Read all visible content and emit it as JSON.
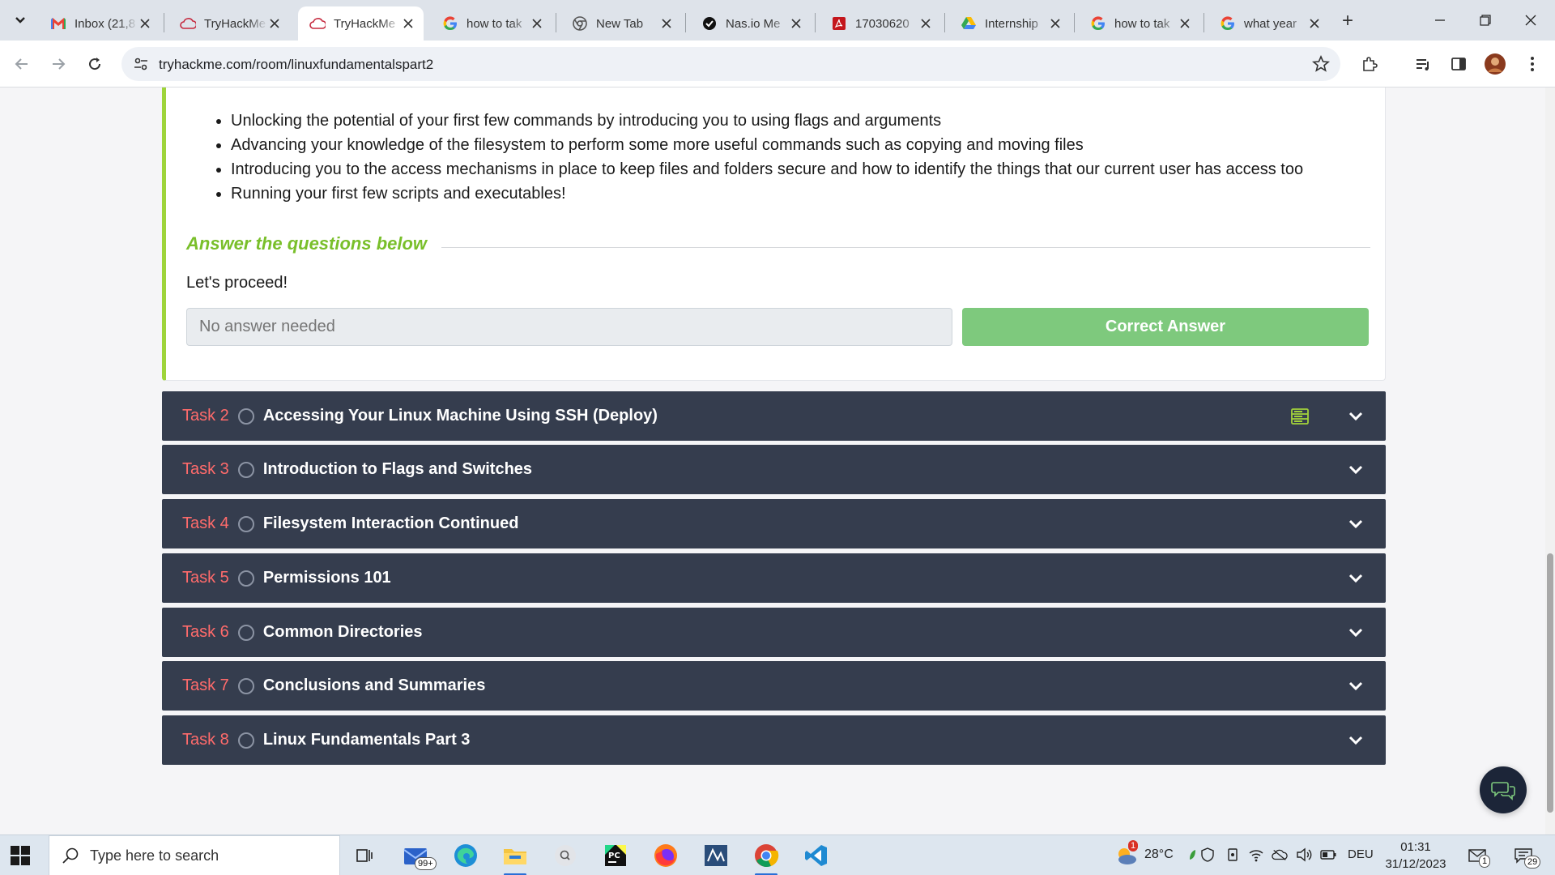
{
  "browser": {
    "tabs": [
      {
        "title": "Inbox (21,8",
        "icon": "gmail-icon",
        "active": false
      },
      {
        "title": "TryHackMe",
        "icon": "tryhackme-icon",
        "active": false
      },
      {
        "title": "TryHackMe",
        "icon": "tryhackme-icon",
        "active": true
      },
      {
        "title": "how to tak",
        "icon": "google-icon",
        "active": false
      },
      {
        "title": "New Tab",
        "icon": "chrome-icon",
        "active": false
      },
      {
        "title": "Nas.io Me",
        "icon": "nasio-icon",
        "active": false
      },
      {
        "title": "17030620",
        "icon": "pdf-icon",
        "active": false
      },
      {
        "title": "Internship",
        "icon": "drive-icon",
        "active": false
      },
      {
        "title": "how to tak",
        "icon": "google-icon",
        "active": false
      },
      {
        "title": "what year",
        "icon": "google-icon",
        "active": false
      }
    ],
    "url": "tryhackme.com/room/linuxfundamentalspart2"
  },
  "task1": {
    "bullets": [
      "Unlocking the potential of your first few commands by introducing you to using flags and arguments",
      "Advancing your knowledge of the filesystem to perform some more useful commands such as copying and moving files",
      "Introducing you to the access mechanisms in place to keep files and folders secure and how to identify the things that our current user has access too",
      "Running your first few scripts and executables!"
    ],
    "answer_heading": "Answer the questions below",
    "question": "Let's proceed!",
    "answer_placeholder": "No answer needed",
    "answer_button": "Correct Answer",
    "accent": "#9ed43a",
    "button_color": "#7ec97d"
  },
  "tasks": [
    {
      "number": "Task 2",
      "title": "Accessing Your Linux Machine Using SSH (Deploy)",
      "has_deploy_icon": true
    },
    {
      "number": "Task 3",
      "title": "Introduction to Flags and Switches",
      "has_deploy_icon": false
    },
    {
      "number": "Task 4",
      "title": "Filesystem Interaction Continued",
      "has_deploy_icon": false
    },
    {
      "number": "Task 5",
      "title": "Permissions 101",
      "has_deploy_icon": false
    },
    {
      "number": "Task 6",
      "title": "Common Directories",
      "has_deploy_icon": false
    },
    {
      "number": "Task 7",
      "title": "Conclusions and Summaries",
      "has_deploy_icon": false
    },
    {
      "number": "Task 8",
      "title": "Linux Fundamentals Part 3",
      "has_deploy_icon": false
    }
  ],
  "task_bar_color": "#353d4e",
  "task_number_color": "#ff6b6b",
  "windows": {
    "search_placeholder": "Type here to search",
    "mail_badge": "99+",
    "weather_badge": "1",
    "temperature": "28°C",
    "language": "DEU",
    "time": "01:31",
    "date": "31/12/2023",
    "notification_count": "29",
    "tray_badge": "1"
  }
}
